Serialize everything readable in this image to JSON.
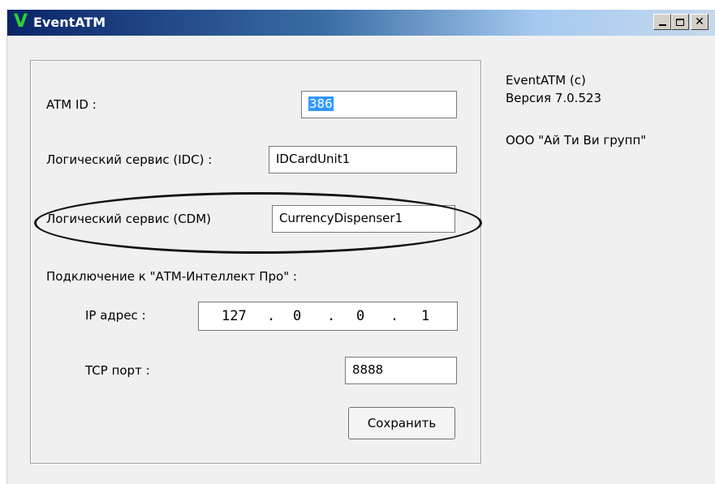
{
  "window": {
    "title": "EventATM",
    "icon_glyph": "V",
    "icon_name": "app-v-icon",
    "minimize_icon": "minimize-icon",
    "maximize_icon": "maximize-icon",
    "close_glyph": "✕",
    "close_icon": "close-icon"
  },
  "form": {
    "atm_id_label": "ATM ID :",
    "atm_id_value": "386",
    "idc_label": "Логический сервис (IDC) :",
    "idc_value": "IDCardUnit1",
    "cdm_label": "Логический сервис (CDM)",
    "cdm_value": "CurrencyDispenser1",
    "connection_label": "Подключение к \"АТМ-Интеллект Про\" :",
    "ip_label": "IP адрес :",
    "ip_octets": [
      "127",
      "0",
      "0",
      "1"
    ],
    "ip_separator": ".",
    "tcp_label": "TCP порт :",
    "tcp_value": "8888",
    "save_label": "Сохранить"
  },
  "info": {
    "product": "EventATM (c)",
    "version": "Версия 7.0.523",
    "company": "ООО \"Ай Ти Ви групп\""
  },
  "colors": {
    "title_gradient_start": "#0a246a",
    "title_gradient_end": "#c6d8ec",
    "selection": "#3399ff",
    "icon_green": "#2fd12f"
  }
}
